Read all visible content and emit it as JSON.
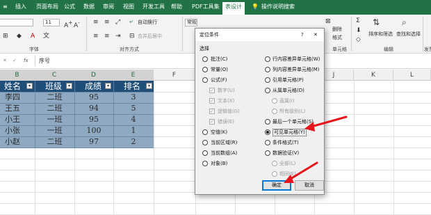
{
  "ribbon_tabs": [
    "插入",
    "页面布局",
    "公式",
    "数据",
    "审阅",
    "视图",
    "开发工具",
    "帮助",
    "PDF工具集",
    "表设计"
  ],
  "search_tab": "操作说明搜索",
  "ribbon": {
    "font_size": "11",
    "font_group_label": "字体",
    "wrap_text": "自动换行",
    "merge_center": "合并后居中",
    "align_group_label": "对齐方式",
    "number_format": "常规",
    "delete": "删除",
    "format": "格式",
    "cells_group_label": "单元格",
    "sort_filter": "排序和筛选",
    "find_select": "查找和选择",
    "edit_group_label": "编辑",
    "send_label": "发票"
  },
  "formula_bar": {
    "fx": "fx",
    "content": "序号"
  },
  "columns": [
    "B",
    "C",
    "D",
    "E",
    "F",
    "G",
    "H",
    "I",
    "J",
    "K",
    "L"
  ],
  "table": {
    "headers": [
      "姓名",
      "班级",
      "成绩",
      "排名"
    ],
    "rows": [
      [
        "李四",
        "二班",
        "95",
        "3"
      ],
      [
        "王五",
        "二班",
        "94",
        "5"
      ],
      [
        "小王",
        "一班",
        "95",
        "4"
      ],
      [
        "小张",
        "一班",
        "100",
        "1"
      ],
      [
        "小赵",
        "二班",
        "97",
        "2"
      ]
    ]
  },
  "dialog": {
    "title": "定位条件",
    "help": "?",
    "close": "✕",
    "section": "选择",
    "left_options": [
      "批注(C)",
      "常量(O)",
      "公式(F)",
      "数字(U)",
      "文本(X)",
      "逻辑值(G)",
      "错误(E)",
      "空值(K)",
      "当前区域(R)",
      "当前数组(A)",
      "对象(B)"
    ],
    "right_options": [
      "行内容差异单元格(W)",
      "列内容差异单元格(M)",
      "引用单元格(P)",
      "从属单元格(D)",
      "直属(I)",
      "所有级别(L)",
      "最后一个单元格(S)",
      "可见单元格(Y)",
      "条件格式(T)",
      "数据验证(V)",
      "全部(L)",
      "相同(E)"
    ],
    "ok": "确定",
    "cancel": "取消"
  },
  "colors": {
    "excel_green": "#217346",
    "table_header": "#1f4e79",
    "selection_fill": "#8ea9c1",
    "arrow_red": "#e8141b"
  }
}
